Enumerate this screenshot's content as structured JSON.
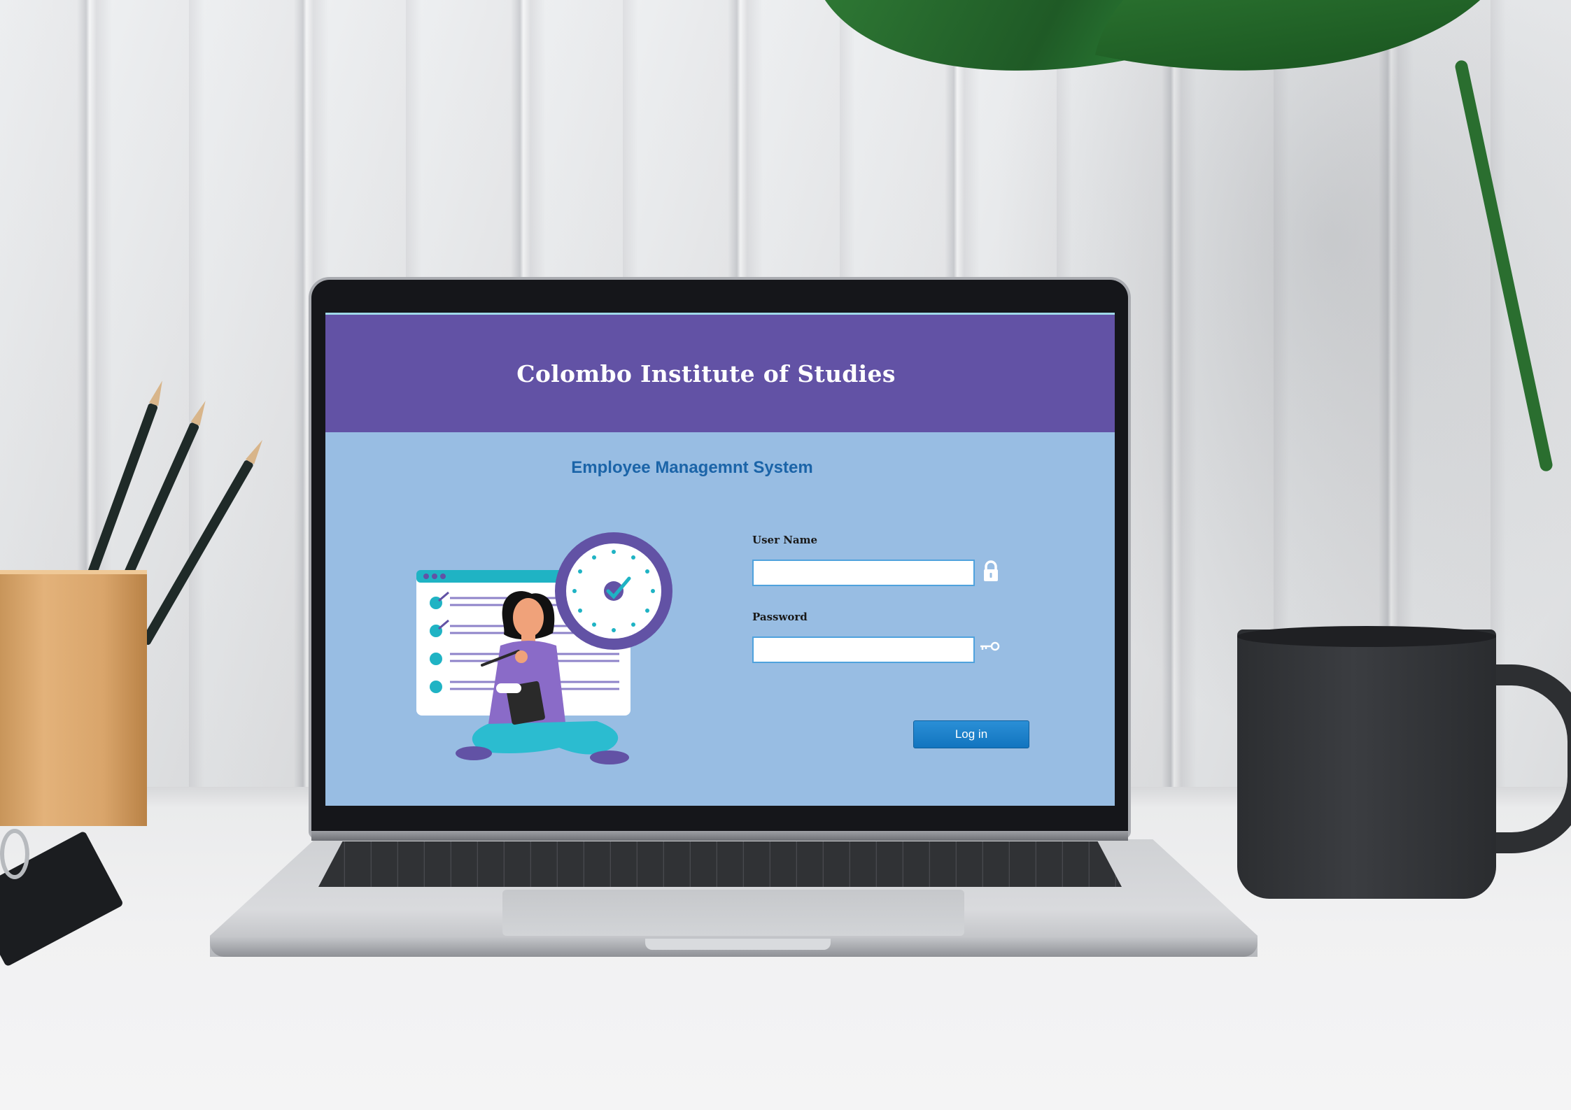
{
  "app": {
    "title": "Colombo Institute of Studies",
    "subtitle": "Employee Managemnt System"
  },
  "login": {
    "username_label": "User Name",
    "username_value": "",
    "password_label": "Password",
    "password_value": "",
    "submit_label": "Log in"
  },
  "icons": {
    "username_field": "lock-icon",
    "password_field": "key-icon"
  },
  "colors": {
    "header": "#6252a5",
    "background": "#98bde3",
    "subtitle": "#1b64a8",
    "button": "#1a7fc8",
    "input_border": "#4fa2dd"
  }
}
